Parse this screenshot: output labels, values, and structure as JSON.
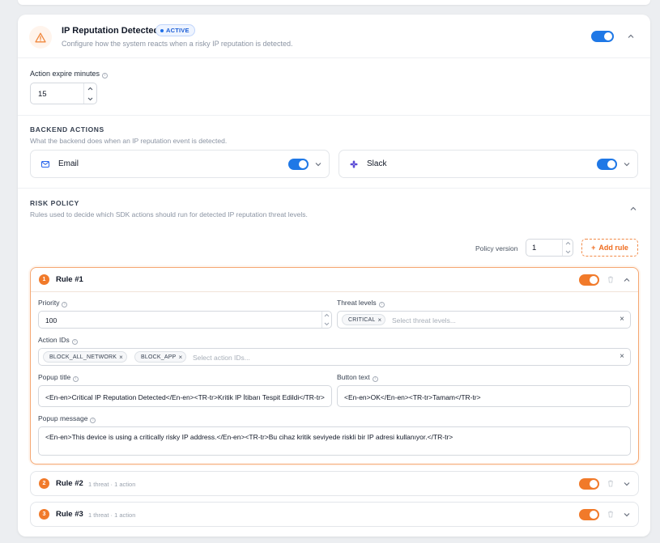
{
  "header": {
    "title": "IP Reputation Detected",
    "badge": "ACTIVE",
    "subtitle": "Configure how the system reacts when a risky IP reputation is detected.",
    "enabled": true
  },
  "expire": {
    "label": "Action expire minutes",
    "value": "15"
  },
  "backend": {
    "heading": "BACKEND ACTIONS",
    "description": "What the backend does when an IP reputation event is detected.",
    "actions": [
      {
        "label": "Email",
        "icon": "mail-icon",
        "enabled": true
      },
      {
        "label": "Slack",
        "icon": "slack-icon",
        "enabled": true
      }
    ]
  },
  "risk_policy": {
    "heading": "RISK POLICY",
    "description": "Rules used to decide which SDK actions should run for detected IP reputation threat levels.",
    "policy_version_label": "Policy version",
    "policy_version": "1",
    "add_rule_label": "Add rule"
  },
  "rules": [
    {
      "number": "1",
      "title": "Rule #1",
      "enabled": true,
      "expanded": true,
      "priority_label": "Priority",
      "priority": "100",
      "threat_label": "Threat levels",
      "threat_levels": [
        "CRITICAL"
      ],
      "threat_placeholder": "Select threat levels...",
      "action_ids_label": "Action IDs",
      "action_ids": [
        "BLOCK_ALL_NETWORK",
        "BLOCK_APP"
      ],
      "action_placeholder": "Select action IDs...",
      "popup_title_label": "Popup title",
      "popup_title": "<En-en>Critical IP Reputation Detected</En-en><TR-tr>Kritik IP İtibarı Tespit Edildi</TR-tr>",
      "button_text_label": "Button text",
      "button_text": "<En-en>OK</En-en><TR-tr>Tamam</TR-tr>",
      "popup_message_label": "Popup message",
      "popup_message": "<En-en>This device is using a critically risky IP address.</En-en><TR-tr>Bu cihaz kritik seviyede riskli bir IP adresi kullanıyor.</TR-tr>"
    },
    {
      "number": "2",
      "title": "Rule #2",
      "meta": "1 threat · 1 action",
      "enabled": true,
      "expanded": false
    },
    {
      "number": "3",
      "title": "Rule #3",
      "meta": "1 threat · 1 action",
      "enabled": true,
      "expanded": false
    }
  ],
  "colors": {
    "accent_blue": "#1f78e6",
    "accent_orange": "#f17a2a",
    "warning_orange": "#f0883e"
  }
}
